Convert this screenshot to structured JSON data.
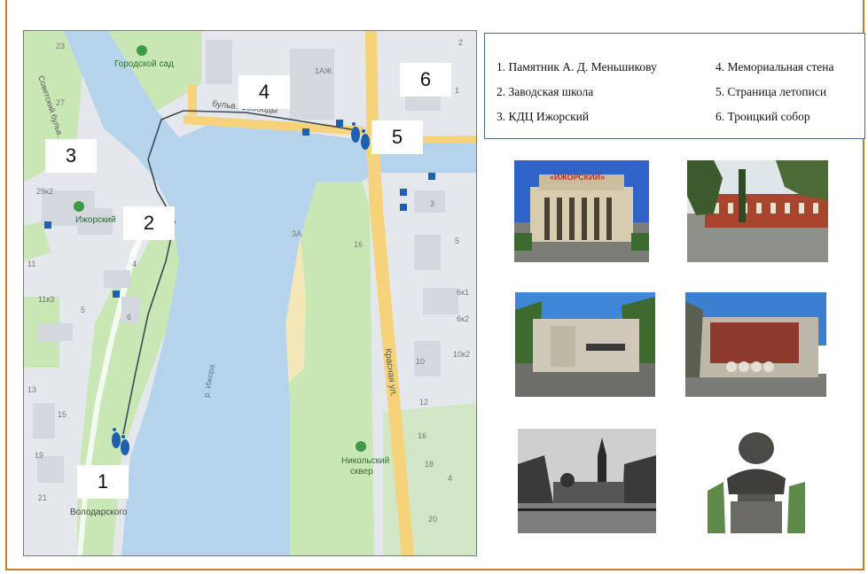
{
  "map": {
    "place_labels": {
      "city_garden": "Городской сад",
      "izhorsky": "Ижорский",
      "nikolsky": "Никольский",
      "nikolsky_2": "сквер",
      "volodarskogo": "Володарского",
      "river": "р. Ижора",
      "krasnaya": "Красная ул.",
      "bulvar": "бульв. Свободы",
      "sovetsky": "Советский бульв."
    },
    "house_numbers": [
      "23",
      "27",
      "19",
      "29к2",
      "11",
      "11к3",
      "13",
      "15",
      "19",
      "21",
      "4",
      "5",
      "6",
      "1АЖ",
      "3А",
      "16",
      "3",
      "5",
      "6к1",
      "6к2",
      "10к2",
      "10",
      "12",
      "16",
      "18",
      "20",
      "4",
      "2",
      "1"
    ],
    "markers": [
      "1",
      "2",
      "3",
      "4",
      "5",
      "6"
    ]
  },
  "legend": {
    "item1": "1. Памятник А. Д. Меньшикову",
    "item2": "2. Заводская школа",
    "item3": "3. КДЦ Ижорский",
    "item4": "4. Мемориальная стена",
    "item5": "5. Страница летописи",
    "item6": "6. Троицкий собор"
  },
  "photos": {
    "kdc_sign": "«ИЖОРСКИЙ»"
  },
  "colors": {
    "border": "#c97a2c",
    "water": "#b6d3ec",
    "park": "#c9e6b5",
    "road": "#f6d27a",
    "route": "#3a4a5a",
    "footprint": "#1f5fb0"
  }
}
